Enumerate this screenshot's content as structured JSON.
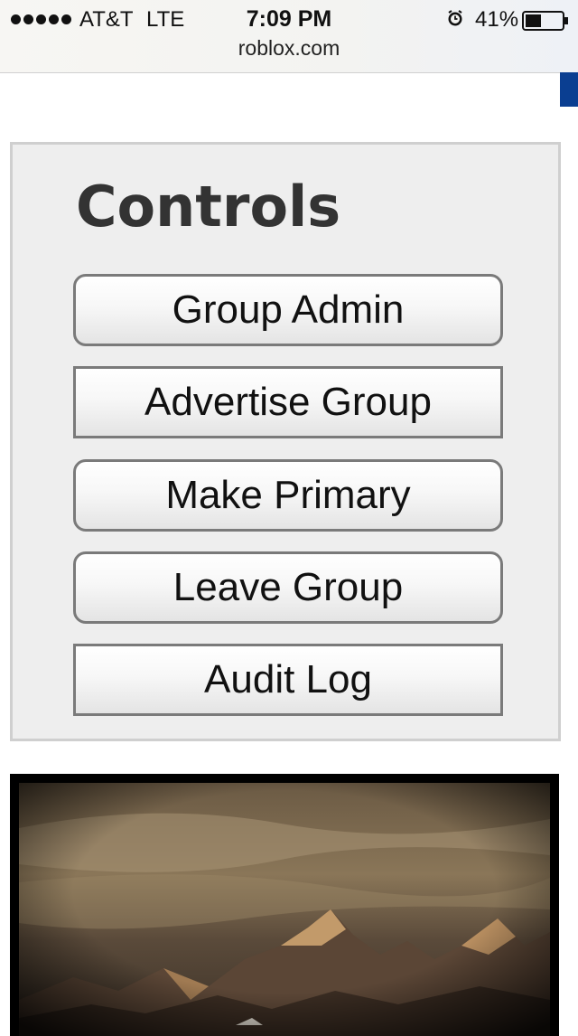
{
  "status_bar": {
    "carrier": "AT&T",
    "network": "LTE",
    "time": "7:09 PM",
    "battery": "41%",
    "url": "roblox.com"
  },
  "controls": {
    "title": "Controls",
    "buttons": [
      {
        "label": "Group Admin"
      },
      {
        "label": "Advertise Group"
      },
      {
        "label": "Make Primary"
      },
      {
        "label": "Leave Group"
      },
      {
        "label": "Audit Log"
      }
    ]
  },
  "colors": {
    "nav_accent": "#0a3e91",
    "panel_bg": "#eeeeee",
    "title_text": "#333333"
  }
}
